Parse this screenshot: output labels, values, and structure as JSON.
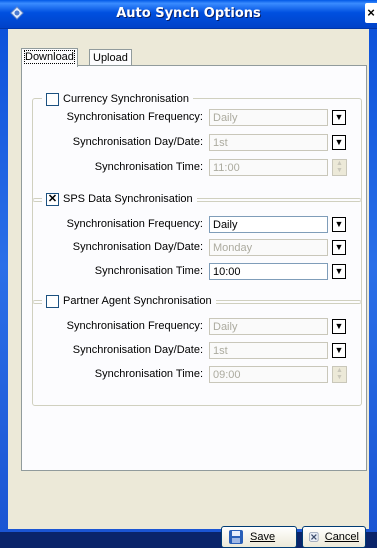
{
  "window": {
    "title": "Auto Synch Options",
    "close_label": "×"
  },
  "tabs": [
    {
      "label": "Download",
      "active": true
    },
    {
      "label": "Upload",
      "active": false
    }
  ],
  "groups": [
    {
      "title": "Currency Synchronisation",
      "checked": false,
      "enabled": false,
      "fields": [
        {
          "label": "Synchronisation Frequency:",
          "value": "Daily"
        },
        {
          "label": "Synchronisation Day/Date:",
          "value": "1st"
        },
        {
          "label": "Synchronisation Time:",
          "value": "11:00"
        }
      ]
    },
    {
      "title": "SPS Data Synchronisation",
      "checked": true,
      "enabled": true,
      "fields": [
        {
          "label": "Synchronisation Frequency:",
          "value": "Daily"
        },
        {
          "label": "Synchronisation Day/Date:",
          "value": "Monday"
        },
        {
          "label": "Synchronisation Time:",
          "value": "10:00"
        }
      ]
    },
    {
      "title": "Partner Agent Synchronisation",
      "checked": false,
      "enabled": false,
      "fields": [
        {
          "label": "Synchronisation Frequency:",
          "value": "Daily"
        },
        {
          "label": "Synchronisation Day/Date:",
          "value": "1st"
        },
        {
          "label": "Synchronisation Time:",
          "value": "09:00"
        }
      ]
    }
  ],
  "buttons": {
    "save_label": "Save",
    "cancel_label": "Cancel"
  },
  "colors": {
    "titlebar": "#0050e0",
    "panel": "#fcfcfe",
    "dialog": "#ece9d8",
    "disabled_text": "#acab9f"
  }
}
